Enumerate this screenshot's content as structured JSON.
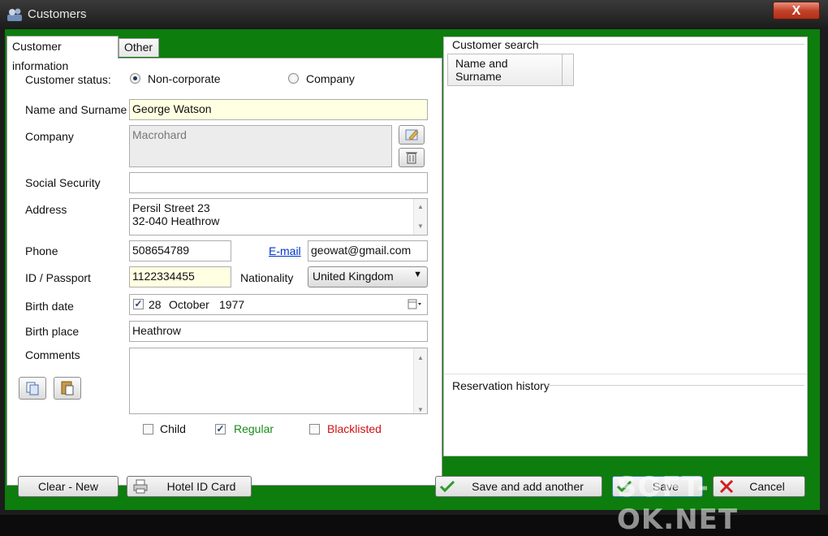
{
  "window": {
    "title": "Customers",
    "close_label": "X"
  },
  "tabs": [
    {
      "label": "Customer information"
    },
    {
      "label": "Other"
    }
  ],
  "form": {
    "customer_status_label": "Customer status:",
    "status_noncorporate": "Non-corporate",
    "status_company": "Company",
    "name_label": "Name and Surname",
    "name_value": "George Watson",
    "company_label": "Company",
    "company_value": "Macrohard",
    "ssn_label": "Social Security",
    "ssn_value": "",
    "address_label": "Address",
    "address_line1": "Persil Street 23",
    "address_line2": "32-040 Heathrow",
    "phone_label": "Phone",
    "phone_value": "508654789",
    "email_label": "E-mail",
    "email_value": "geowat@gmail.com",
    "id_label": "ID / Passport",
    "id_value": "1122334455",
    "nationality_label": "Nationality",
    "nationality_value": "United Kingdom",
    "birth_date_label": "Birth date",
    "birth_day": "28",
    "birth_month": "October",
    "birth_year": "1977",
    "birth_place_label": "Birth place",
    "birth_place_value": "Heathrow",
    "comments_label": "Comments",
    "comments_value": "",
    "flag_child": "Child",
    "flag_regular": "Regular",
    "flag_blacklisted": "Blacklisted"
  },
  "right": {
    "search_group": "Customer search",
    "grid_column": "Name and Surname",
    "grid_column_line1": "Name and",
    "grid_column_line2": "Surname",
    "history_group": "Reservation history"
  },
  "footer": {
    "clear_new": "Clear - New",
    "hotel_id_card": "Hotel ID Card",
    "save_add_another": "Save and add another",
    "save": "Save",
    "cancel": "Cancel"
  },
  "watermark": "SOFT-OK.NET",
  "colors": {
    "background": "#0d7d0d",
    "regular": "#1a8a1a",
    "blacklisted": "#d01010",
    "link": "#0033cc",
    "field_highlight": "#ffffe1"
  }
}
